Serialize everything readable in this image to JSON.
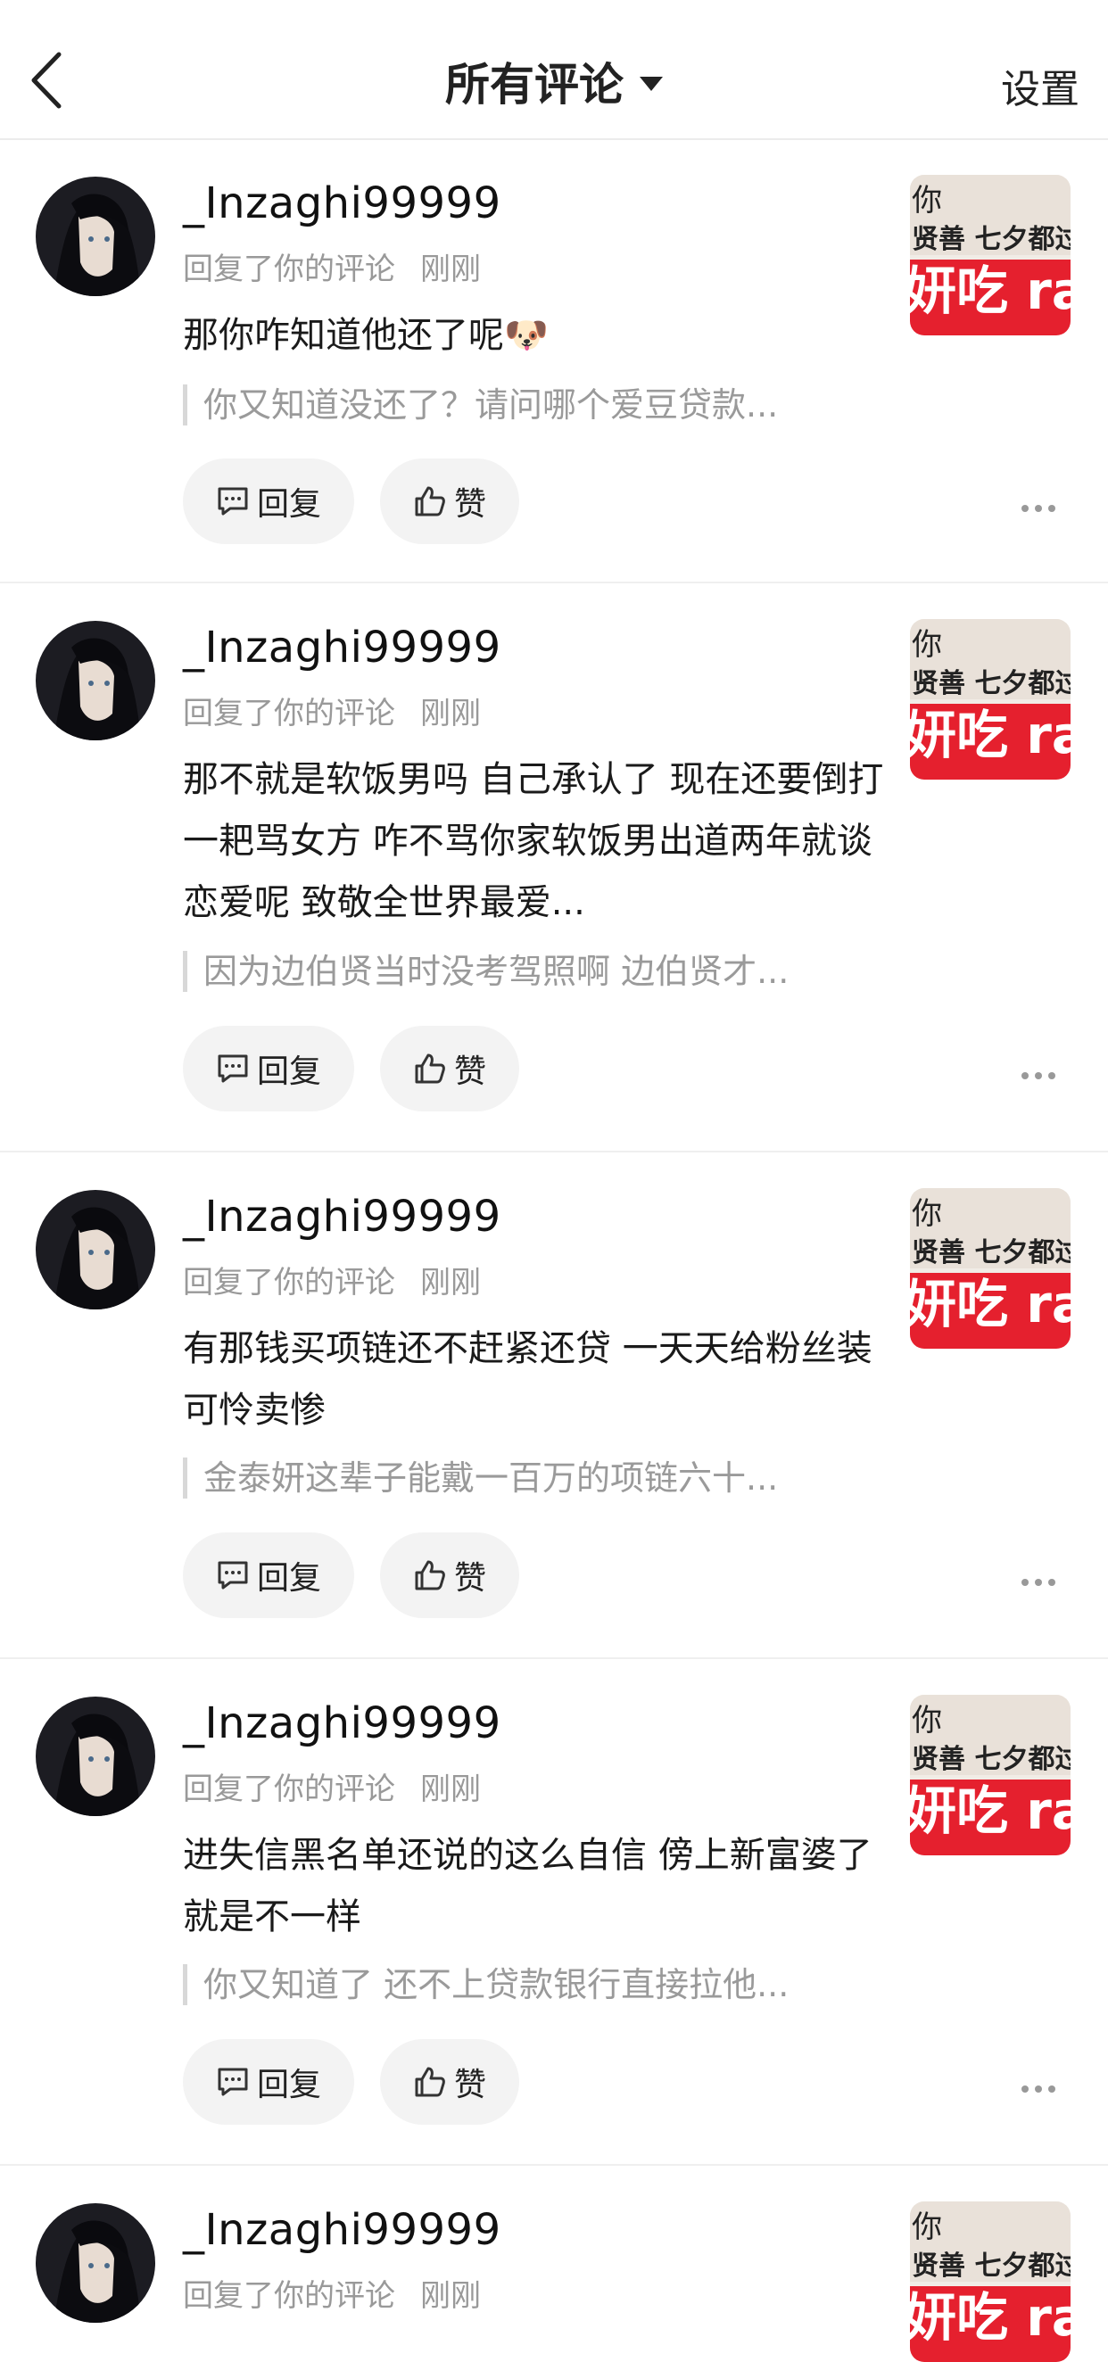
{
  "header": {
    "title": "所有评论",
    "settings_label": "设置"
  },
  "comments": [
    {
      "username": "_Inzaghi99999",
      "action": "回复了你的评论",
      "time": "刚刚",
      "content": "那你咋知道他还了呢🐶",
      "quote": "你又知道没还了？请问哪个爱豆贷款...",
      "reply_label": "回复",
      "like_label": "赞"
    },
    {
      "username": "_Inzaghi99999",
      "action": "回复了你的评论",
      "time": "刚刚",
      "content": "那不就是软饭男吗 自己承认了 现在还要倒打一耙骂女方 咋不骂你家软饭男出道两年就谈恋爱呢 致敬全世界最爱...",
      "quote": "因为边伯贤当时没考驾照啊 边伯贤才...",
      "reply_label": "回复",
      "like_label": "赞"
    },
    {
      "username": "_Inzaghi99999",
      "action": "回复了你的评论",
      "time": "刚刚",
      "content": "有那钱买项链还不赶紧还贷 一天天给粉丝装可怜卖惨",
      "quote": "金泰妍这辈子能戴一百万的项链六十...",
      "reply_label": "回复",
      "like_label": "赞"
    },
    {
      "username": "_Inzaghi99999",
      "action": "回复了你的评论",
      "time": "刚刚",
      "content": "进失信黑名单还说的这么自信 傍上新富婆了就是不一样",
      "quote": "你又知道了 还不上贷款银行直接拉他...",
      "reply_label": "回复",
      "like_label": "赞"
    },
    {
      "username": "_Inzaghi99999",
      "action": "回复了你的评论",
      "time": "刚刚"
    }
  ],
  "thumbnail": {
    "line1": "你",
    "line2": "贤善 七夕都过",
    "line3": "妍吃 ra"
  }
}
